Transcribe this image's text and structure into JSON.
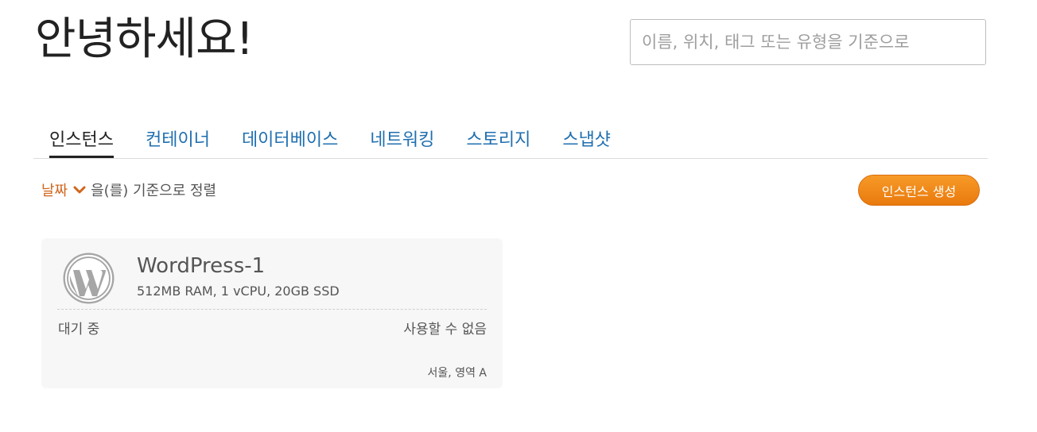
{
  "header": {
    "greeting": "안녕하세요!",
    "search_placeholder": "이름, 위치, 태그 또는 유형을 기준으로"
  },
  "tabs": [
    {
      "label": "인스턴스",
      "active": true
    },
    {
      "label": "컨테이너",
      "active": false
    },
    {
      "label": "데이터베이스",
      "active": false
    },
    {
      "label": "네트워킹",
      "active": false
    },
    {
      "label": "스토리지",
      "active": false
    },
    {
      "label": "스냅샷",
      "active": false
    }
  ],
  "sort": {
    "selected": "날짜",
    "suffix": "을(를) 기준으로 정렬",
    "icon": "chevron-down-icon"
  },
  "actions": {
    "create_label": "인스턴스 생성"
  },
  "instances": [
    {
      "name": "WordPress-1",
      "spec": "512MB RAM, 1 vCPU, 20GB SSD",
      "state": "대기 중",
      "status": "사용할 수 없음",
      "region": "서울, 영역 A",
      "icon": "wordpress-logo-icon"
    }
  ],
  "colors": {
    "accent_orange": "#e97a0d",
    "link_blue": "#1f6fb0",
    "sort_orange": "#d0651a",
    "card_bg": "#f7f7f7"
  }
}
